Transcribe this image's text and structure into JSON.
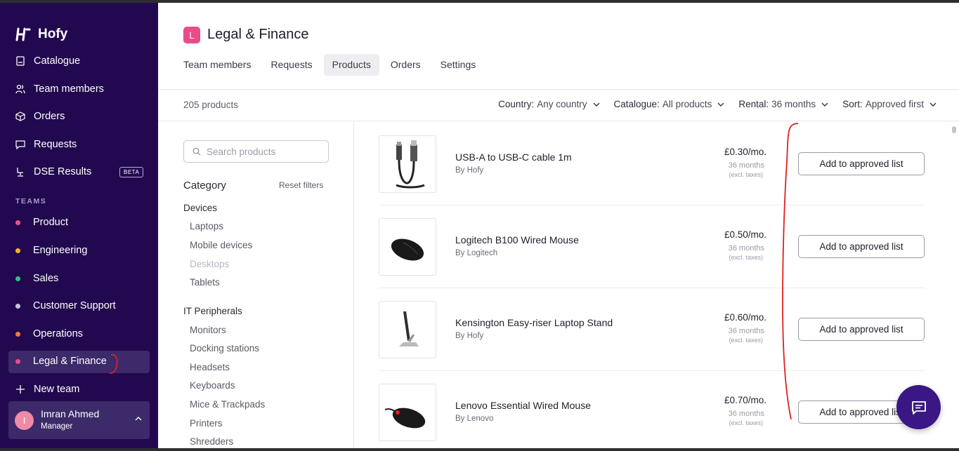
{
  "brand": {
    "name": "Hofy"
  },
  "sidebar": {
    "nav": [
      {
        "label": "Catalogue",
        "icon": "catalogue-icon"
      },
      {
        "label": "Team members",
        "icon": "users-icon"
      },
      {
        "label": "Orders",
        "icon": "box-icon"
      },
      {
        "label": "Requests",
        "icon": "chat-icon"
      },
      {
        "label": "DSE Results",
        "icon": "desk-chair-icon",
        "badge": "BETA"
      }
    ],
    "teams_label": "TEAMS",
    "teams": [
      {
        "label": "Product",
        "color": "#f0547a"
      },
      {
        "label": "Engineering",
        "color": "#f5b324"
      },
      {
        "label": "Sales",
        "color": "#2ec27e"
      },
      {
        "label": "Customer Support",
        "color": "#c9c3d9"
      },
      {
        "label": "Operations",
        "color": "#f37b3a"
      },
      {
        "label": "Legal & Finance",
        "color": "#ea4c89"
      }
    ],
    "new_team": "New team",
    "user": {
      "initial": "I",
      "name": "Imran Ahmed",
      "role": "Manager"
    }
  },
  "header": {
    "team_initial": "L",
    "title": "Legal & Finance",
    "tabs": [
      "Team members",
      "Requests",
      "Products",
      "Orders",
      "Settings"
    ],
    "active_tab": "Products"
  },
  "toolbar": {
    "count": "205 products",
    "filters": [
      {
        "key": "Country:",
        "value": "Any country"
      },
      {
        "key": "Catalogue:",
        "value": "All products"
      },
      {
        "key": "Rental:",
        "value": "36 months"
      },
      {
        "key": "Sort:",
        "value": "Approved first"
      }
    ]
  },
  "filters_panel": {
    "search_placeholder": "Search products",
    "category_title": "Category",
    "reset": "Reset filters",
    "groups": [
      {
        "label": "Devices",
        "items": [
          "Laptops",
          "Mobile devices",
          "Desktops",
          "Tablets"
        ]
      },
      {
        "label": "IT Peripherals",
        "items": [
          "Monitors",
          "Docking stations",
          "Headsets",
          "Keyboards",
          "Mice & Trackpads",
          "Printers",
          "Shredders"
        ]
      }
    ]
  },
  "products": [
    {
      "name": "USB-A to USB-C cable 1m",
      "brand": "By Hofy",
      "price": "£0.30/mo.",
      "term": "36 months",
      "tax": "(excl. taxes)",
      "action": "Add to approved list",
      "icon": "usb-cable-icon"
    },
    {
      "name": "Logitech B100 Wired Mouse",
      "brand": "By Logitech",
      "price": "£0.50/mo.",
      "term": "36 months",
      "tax": "(excl. taxes)",
      "action": "Add to approved list",
      "icon": "mouse-icon"
    },
    {
      "name": "Kensington Easy-riser Laptop Stand",
      "brand": "By Hofy",
      "price": "£0.60/mo.",
      "term": "36 months",
      "tax": "(excl. taxes)",
      "action": "Add to approved list",
      "icon": "laptop-stand-icon"
    },
    {
      "name": "Lenovo Essential Wired Mouse",
      "brand": "By Lenovo",
      "price": "£0.70/mo.",
      "term": "36 months",
      "tax": "(excl. taxes)",
      "action": "Add to approved list",
      "icon": "mouse-icon"
    }
  ],
  "colors": {
    "sidebar": "#22094f",
    "accent": "#ea4c89",
    "fab": "#3a1784"
  }
}
